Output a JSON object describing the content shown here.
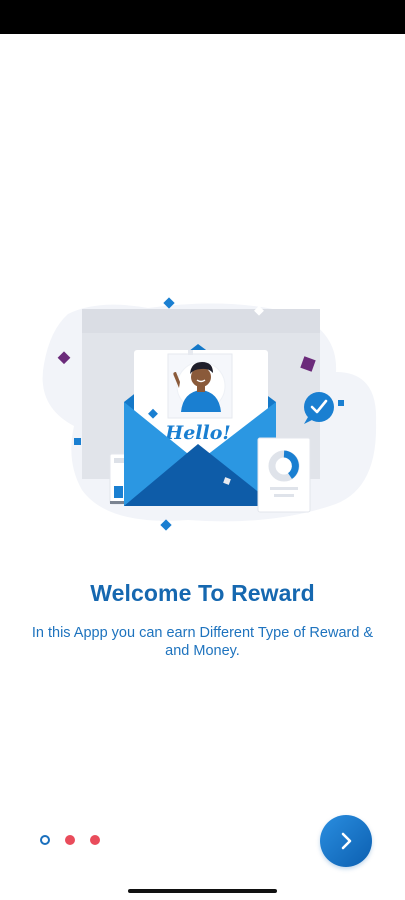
{
  "onboarding": {
    "title": "Welcome To Reward",
    "description": "In this Appp you can earn Different Type of Reward & and Money.",
    "illustration": {
      "greeting": "Hello!",
      "colors": {
        "primary_blue": "#1a7fd1",
        "dark_blue": "#0e5ca8",
        "purple_confetti": "#6b2a7a",
        "blob": "#f1f3f8"
      }
    }
  },
  "pagination": {
    "total_pages": 3,
    "current_page": 1,
    "active_color": "#1a6fbd",
    "inactive_color": "#e94c5b"
  },
  "next_button": {
    "icon": "chevron-right-icon",
    "color": "#1a7fd1"
  }
}
